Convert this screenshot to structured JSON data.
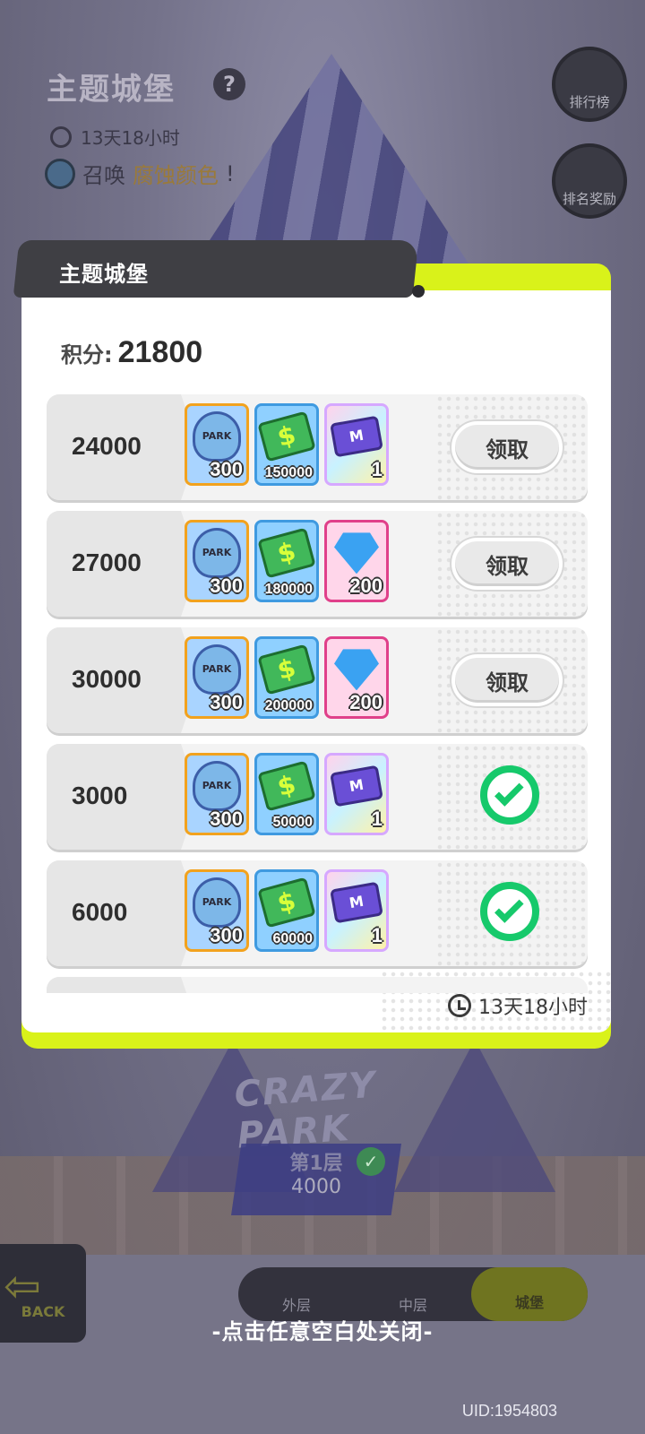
{
  "background": {
    "title": "主题城堡",
    "help": "?",
    "timer": "13天18小时",
    "summon_prefix": "召唤",
    "summon_highlight": "腐蚀颜色",
    "summon_suffix": "!",
    "side_buttons": [
      {
        "label": "排行榜",
        "icon": "trophy-icon"
      },
      {
        "label": "排名奖励",
        "icon": "gift-icon"
      }
    ],
    "sign": "CRAZY PARK",
    "floor_label": "第1层",
    "floor_points": "4000",
    "back_label": "BACK",
    "tabs": [
      {
        "label": "外层",
        "active": false
      },
      {
        "label": "中层",
        "active": false
      },
      {
        "label": "城堡",
        "active": true
      }
    ],
    "close_hint": "-点击任意空白处关闭-",
    "uid": "UID:1954803"
  },
  "modal": {
    "title": "主题城堡",
    "score_label": "积分:",
    "score_value": "21800",
    "claim_label": "领取",
    "timer": "13天18小时",
    "colors": {
      "accent": "#d9f21a",
      "header": "#3f3f44",
      "check": "#16c96b"
    },
    "rows": [
      {
        "threshold": "24000",
        "status": "claimable",
        "rewards": [
          {
            "type": "park",
            "icon": "park-token-icon",
            "count": "300"
          },
          {
            "type": "coin",
            "icon": "cash-icon",
            "count": "150000"
          },
          {
            "type": "ticket",
            "icon": "ticket-icon",
            "count": "1"
          }
        ]
      },
      {
        "threshold": "27000",
        "status": "claimable",
        "rewards": [
          {
            "type": "park",
            "icon": "park-token-icon",
            "count": "300"
          },
          {
            "type": "coin",
            "icon": "cash-icon",
            "count": "180000"
          },
          {
            "type": "gem",
            "icon": "diamond-icon",
            "count": "200"
          }
        ]
      },
      {
        "threshold": "30000",
        "status": "claimable",
        "rewards": [
          {
            "type": "park",
            "icon": "park-token-icon",
            "count": "300"
          },
          {
            "type": "coin",
            "icon": "cash-icon",
            "count": "200000"
          },
          {
            "type": "gem",
            "icon": "diamond-icon",
            "count": "200"
          }
        ]
      },
      {
        "threshold": "3000",
        "status": "claimed",
        "rewards": [
          {
            "type": "park",
            "icon": "park-token-icon",
            "count": "300"
          },
          {
            "type": "coin",
            "icon": "cash-icon",
            "count": "50000"
          },
          {
            "type": "ticket",
            "icon": "ticket-icon",
            "count": "1"
          }
        ]
      },
      {
        "threshold": "6000",
        "status": "claimed",
        "rewards": [
          {
            "type": "park",
            "icon": "park-token-icon",
            "count": "300"
          },
          {
            "type": "coin",
            "icon": "cash-icon",
            "count": "60000"
          },
          {
            "type": "ticket",
            "icon": "ticket-icon",
            "count": "1"
          }
        ]
      }
    ]
  }
}
